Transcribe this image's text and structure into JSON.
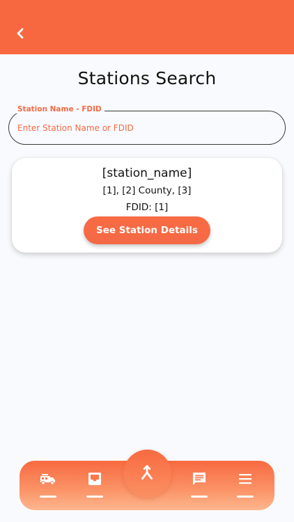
{
  "theme": {
    "accent": "#f86840",
    "label_color": "#f36a45"
  },
  "header": {
    "back_icon": "chevron-left-icon"
  },
  "page": {
    "title": "Stations Search"
  },
  "search": {
    "label": "Station Name - FDID",
    "placeholder": "Enter Station Name or FDID",
    "value": ""
  },
  "result_card": {
    "station_name": "[station_name]",
    "location": "[1], [2] County, [3]",
    "fdid": "FDID: [1]",
    "button_label": "See Station Details"
  },
  "bottom_nav": {
    "items": [
      {
        "icon": "fire-truck-icon"
      },
      {
        "icon": "inbox-icon"
      },
      {
        "icon": "merge-icon"
      },
      {
        "icon": "message-icon"
      },
      {
        "icon": "menu-icon"
      }
    ]
  }
}
